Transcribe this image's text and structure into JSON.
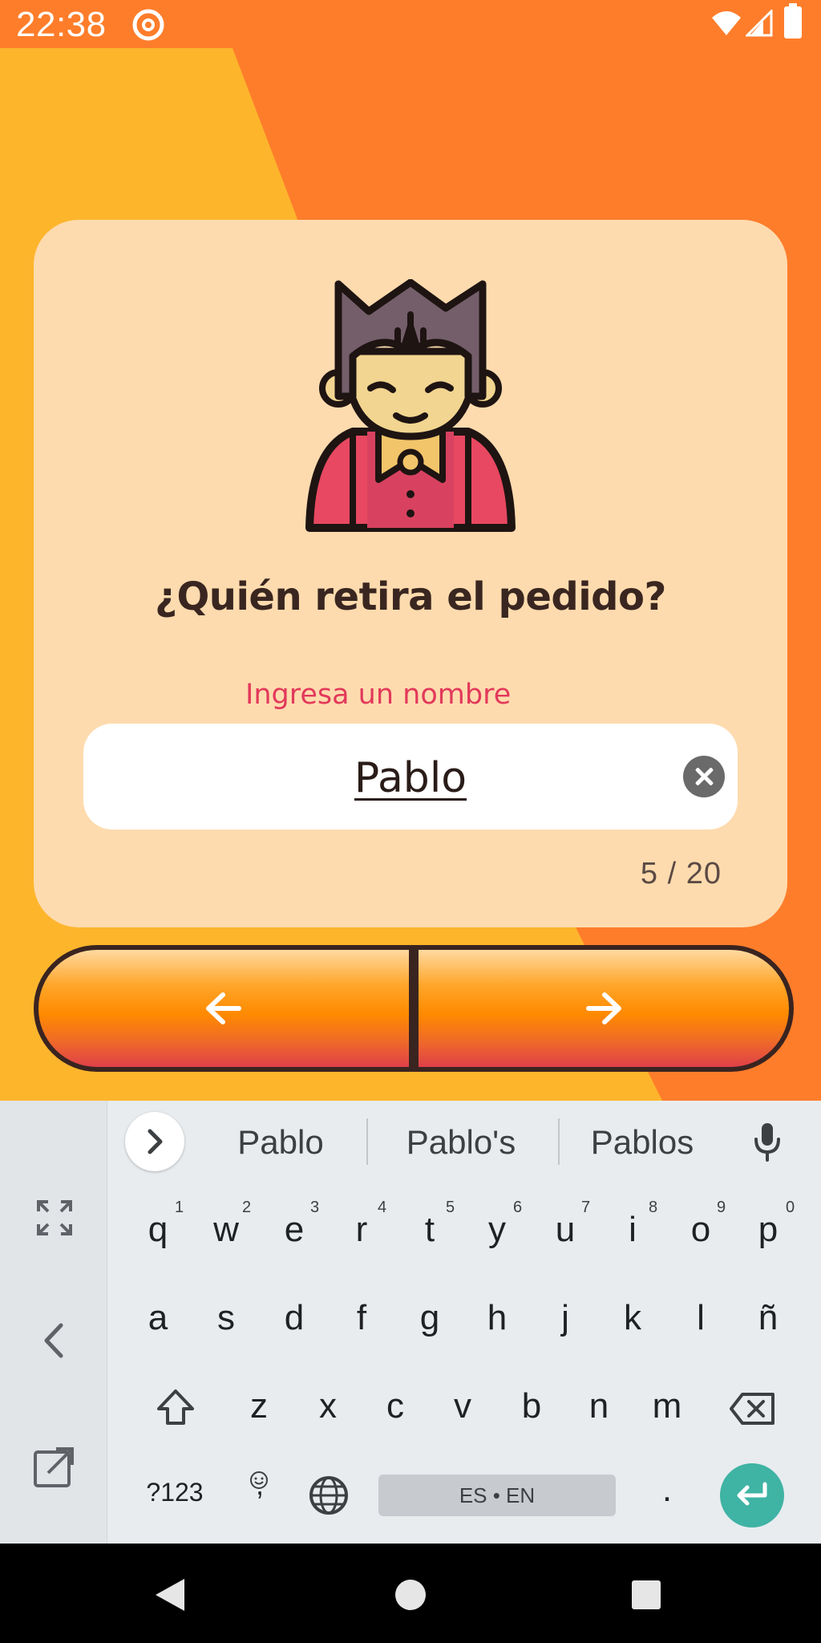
{
  "status_bar": {
    "time": "22:38"
  },
  "card": {
    "question": "¿Quién retira el pedido?",
    "field_label": "Ingresa un nombre",
    "input_value": "Pablo",
    "counter": "5 / 20"
  },
  "colors": {
    "background_orange": "#fe7d2b",
    "background_yellow": "#fdb52c",
    "card": "#fedbae",
    "label_red": "#e2395b",
    "enter_key": "#3fb3a4"
  },
  "navigation": {
    "back_icon": "arrow-left-icon",
    "next_icon": "arrow-right-icon"
  },
  "keyboard": {
    "suggestions": [
      "Pablo",
      "Pablo's",
      "Pablos"
    ],
    "row1": [
      "q",
      "w",
      "e",
      "r",
      "t",
      "y",
      "u",
      "i",
      "o",
      "p"
    ],
    "row1_hints": [
      "1",
      "2",
      "3",
      "4",
      "5",
      "6",
      "7",
      "8",
      "9",
      "0"
    ],
    "row2": [
      "a",
      "s",
      "d",
      "f",
      "g",
      "h",
      "j",
      "k",
      "l",
      "ñ"
    ],
    "row3": [
      "z",
      "x",
      "c",
      "v",
      "b",
      "n",
      "m"
    ],
    "symbols_key": "?123",
    "comma_key": ",",
    "period_key": ".",
    "space_label": "ES • EN"
  }
}
